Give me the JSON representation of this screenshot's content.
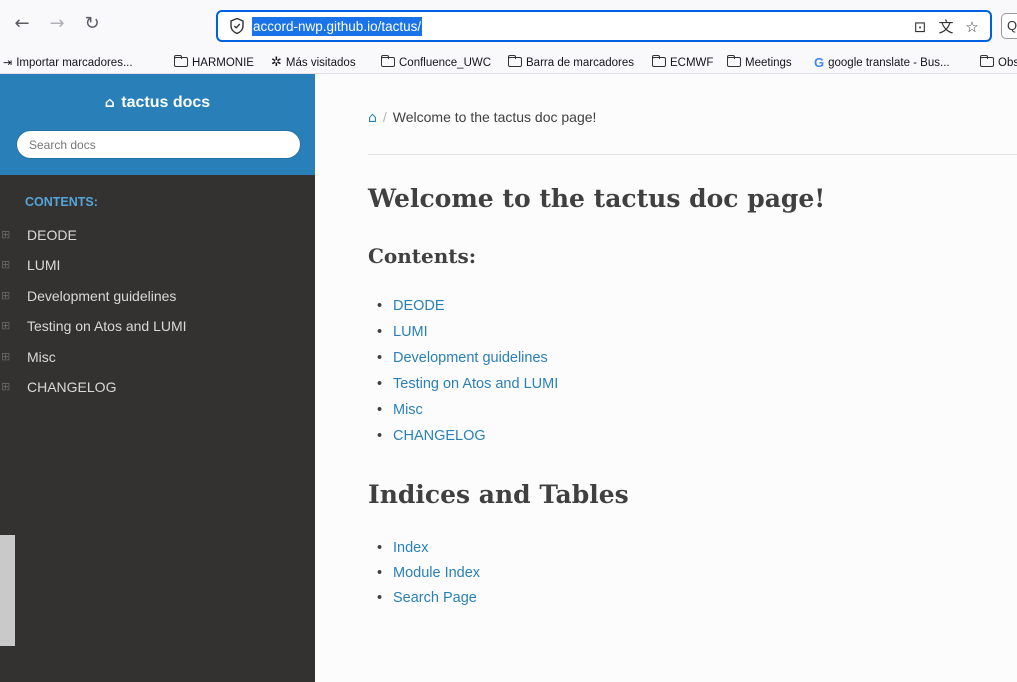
{
  "browser": {
    "url": "accord-nwp.github.io/tactus/",
    "bookmarks": [
      {
        "label": "Importar marcadores...",
        "icon": "import-icon"
      },
      {
        "label": "HARMONIE",
        "icon": "folder-icon"
      },
      {
        "label": "Más visitados",
        "icon": "gear-icon"
      },
      {
        "label": "Confluence_UWC",
        "icon": "folder-icon"
      },
      {
        "label": "Barra de marcadores",
        "icon": "folder-icon"
      },
      {
        "label": "ECMWF",
        "icon": "folder-icon"
      },
      {
        "label": "Meetings",
        "icon": "folder-icon"
      },
      {
        "label": "google translate - Bus...",
        "icon": "google-icon"
      },
      {
        "label": "Obs",
        "icon": "folder-icon"
      }
    ]
  },
  "sidebar": {
    "title": "tactus docs",
    "search_placeholder": "Search docs",
    "caption": "CONTENTS:",
    "items": [
      {
        "label": "DEODE"
      },
      {
        "label": "LUMI"
      },
      {
        "label": "Development guidelines"
      },
      {
        "label": "Testing on Atos and LUMI"
      },
      {
        "label": "Misc"
      },
      {
        "label": "CHANGELOG"
      }
    ]
  },
  "main": {
    "breadcrumb": "Welcome to the tactus doc page!",
    "title": "Welcome to the tactus doc page!",
    "contents_heading": "Contents:",
    "contents": [
      "DEODE",
      "LUMI",
      "Development guidelines",
      "Testing on Atos and LUMI",
      "Misc",
      "CHANGELOG"
    ],
    "indices_heading": "Indices and Tables",
    "indices": [
      "Index",
      "Module Index",
      "Search Page"
    ]
  },
  "colors": {
    "accent": "#2980b9",
    "sidebar_bg": "#343131",
    "text": "#404040"
  }
}
